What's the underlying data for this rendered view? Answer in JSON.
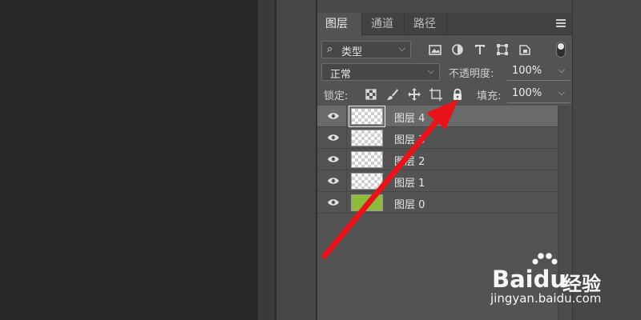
{
  "tabs": [
    {
      "label": "图层",
      "active": true
    },
    {
      "label": "通道",
      "active": false
    },
    {
      "label": "路径",
      "active": false
    }
  ],
  "filter": {
    "search_glyph": "⌕",
    "kind_label": "类型",
    "icons": [
      "image-filter-icon",
      "adjustment-filter-icon",
      "type-filter-icon",
      "shape-filter-icon",
      "smart-object-filter-icon"
    ]
  },
  "blend": {
    "mode": "正常",
    "opacity_label": "不透明度:",
    "opacity_value": "100%"
  },
  "lock": {
    "label": "锁定:",
    "fill_label": "填充:",
    "fill_value": "100%",
    "icons": [
      "lock-transparent-icon",
      "lock-image-icon",
      "lock-position-icon",
      "lock-artboard-icon",
      "lock-all-icon"
    ]
  },
  "layers": [
    {
      "name": "图层 4",
      "selected": true,
      "thumb": "transparent"
    },
    {
      "name": "图层 3",
      "selected": false,
      "thumb": "transparent"
    },
    {
      "name": "图层 2",
      "selected": false,
      "thumb": "transparent"
    },
    {
      "name": "图层 1",
      "selected": false,
      "thumb": "transparent"
    },
    {
      "name": "图层 0",
      "selected": false,
      "thumb": "solid"
    }
  ],
  "colors": {
    "arrow": "#e8141a",
    "layer0_fill": "#8fbb3a"
  },
  "watermark": {
    "brand_bai": "Bai",
    "brand_du": "du",
    "brand_cn": "经验",
    "url": "jingyan.baidu.com"
  }
}
